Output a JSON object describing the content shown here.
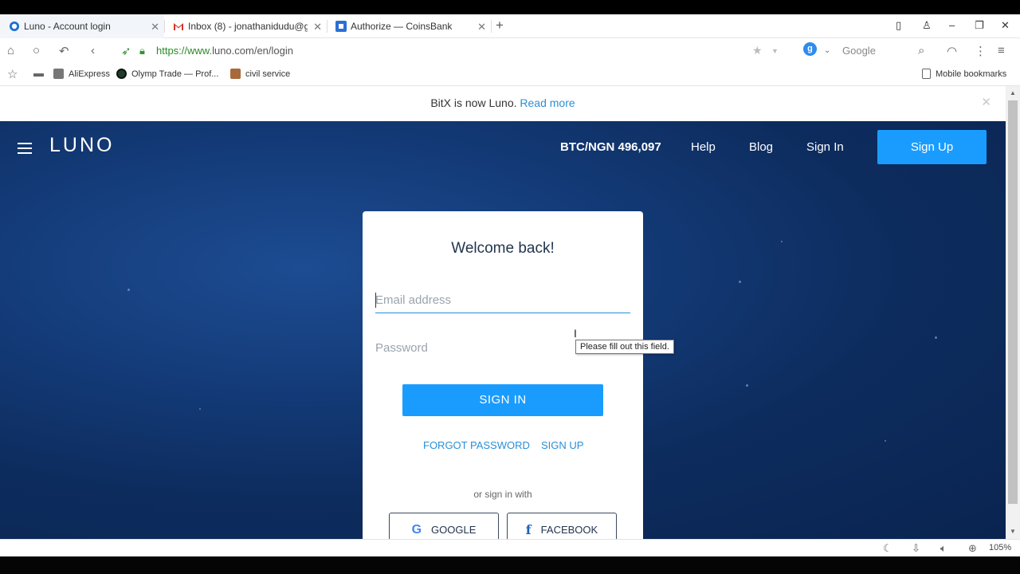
{
  "tabs": [
    {
      "label": "Luno - Account login",
      "active": true
    },
    {
      "label": "Inbox (8) - jonathanidudu@gn",
      "active": false
    },
    {
      "label": "Authorize — CoinsBank",
      "active": false
    }
  ],
  "address": {
    "url_prefix": "https://www.",
    "url_domain": "luno.com/en/login",
    "search_engine_letter": "g",
    "search_label": "Google"
  },
  "bookmarks": [
    "AliExpress",
    "Olymp Trade — Prof...",
    "civil service"
  ],
  "mobile_bookmarks": "Mobile bookmarks",
  "notice": {
    "text": "BitX is now Luno.",
    "link": "Read more",
    "close": "✕"
  },
  "header": {
    "logo": "LUNO",
    "price": "BTC/NGN 496,097",
    "help": "Help",
    "blog": "Blog",
    "signin": "Sign In",
    "signup": "Sign Up"
  },
  "login": {
    "title": "Welcome back!",
    "email_placeholder": "Email address",
    "password_placeholder": "Password",
    "submit": "SIGN IN",
    "forgot": "FORGOT PASSWORD",
    "signup": "SIGN UP",
    "or_text": "or sign in with",
    "google": "GOOGLE",
    "facebook": "FACEBOOK"
  },
  "tooltip": "Please fill out this field.",
  "status": {
    "zoom": "105%"
  },
  "colors": {
    "accent": "#1a9cff",
    "link": "#2a8fd6",
    "hero": "#0d2c5e"
  }
}
